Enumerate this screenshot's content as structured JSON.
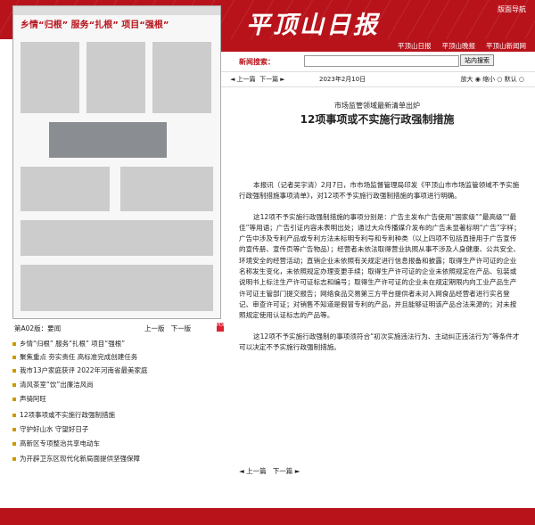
{
  "header": {
    "logo_text": "平顶山日报",
    "guide_link": "版面导航"
  },
  "subnav": {
    "links": [
      "平顶山日报",
      "平顶山晚报",
      "平顶山新闻网"
    ]
  },
  "search": {
    "label": "新闻搜索：",
    "value": "",
    "button": "站内搜索"
  },
  "toolbar": {
    "prev": "上一篇",
    "next": "下一篇",
    "date": "2023年2月10日",
    "font_label": "放大",
    "font_mid": "缩小",
    "font_default": "默认"
  },
  "paper": {
    "headline": "乡情“归根” 服务“扎根” 项目“强根”",
    "page_name": "第A02版：要闻",
    "prev_page": "上一版",
    "next_page": "下一版",
    "pdf_label": "PDF"
  },
  "article_list": [
    "乡情“归根” 服务“扎根” 项目“强根”",
    "聚焦重点 夯实责任 高标准完成创建任务",
    "我市13户家庭获评 2022年河南省最美家庭",
    "清风茶室“饮”出廉洁风尚",
    "声骑阿旺",
    "12项事项或不实施行政强制措施",
    "守护好山水 守望好日子",
    "高新区专项整治共享电动车",
    "为开辟卫东区现代化新局面提供坚强保障"
  ],
  "article": {
    "subtitle": "市场监管领域最新清单出炉",
    "title": "12项事项或不实施行政强制措施",
    "paragraphs": [
      "本报讯（记者吴宇清）2月7日，市市场监督管理局印发《平顶山市市场监管领域不予实施行政强制措施事项清单》，对12项不予实施行政强制措施的事项进行明确。",
      "这12项不予实施行政强制措施的事项分别是：广告主发布广告使用“国家级”“最高级”“最佳”等用语；广告引证内容未表明出处；通过大众传播媒介发布的广告未显著标明“广告”字样；广告中涉及专利产品或专利方法未标明专利号和专利种类（以上四项不包括直接用于广告宣传的宣传册、宣传页等广告物品）；经营者未依法取得营业执照从事不涉及人身健康、公共安全、环境安全的经营活动；直销企业未依照有关规定进行信息报备和披露；取得生产许可证的企业名称发生变化，未依照规定办理变更手续；取得生产许可证的企业未依照规定在产品、包装或说明书上标注生产许可证标志和编号；取得生产许可证的企业未在规定期限内向工业产品生产许可证主管部门提交报告；网络食品交易第三方平台提供者未对入网食品经营者进行实名登记、审查许可证；对销售不知道是假冒专利的产品，并且能够证明该产品合法来源的；对未按照规定使用认证标志的产品等。",
      "这12项不予实施行政强制的事项须符合“初次实施违法行为、主动纠正违法行为”等条件才可以决定不予实施行政强制措施。"
    ]
  }
}
